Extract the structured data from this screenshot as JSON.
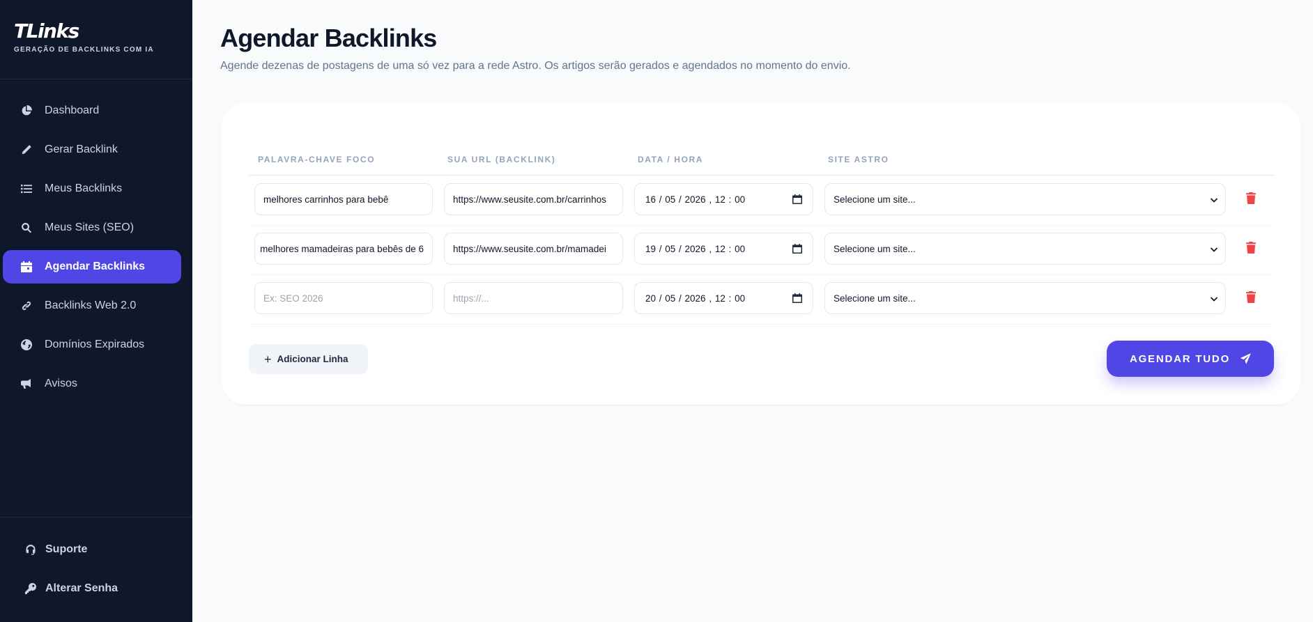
{
  "brand": {
    "title": "TLinks",
    "subtitle": "GERAÇÃO DE BACKLINKS COM IA"
  },
  "sidebar": {
    "items": [
      {
        "label": "Dashboard",
        "icon": "pie-chart-icon"
      },
      {
        "label": "Gerar Backlink",
        "icon": "pencil-icon"
      },
      {
        "label": "Meus Backlinks",
        "icon": "list-icon"
      },
      {
        "label": "Meus Sites (SEO)",
        "icon": "search-icon"
      },
      {
        "label": "Agendar Backlinks",
        "icon": "calendar-icon",
        "active": true
      },
      {
        "label": "Backlinks Web 2.0",
        "icon": "link-icon"
      },
      {
        "label": "Domínios Expirados",
        "icon": "globe-icon"
      },
      {
        "label": "Avisos",
        "icon": "megaphone-icon"
      }
    ],
    "footer": [
      {
        "label": "Suporte",
        "icon": "headset-icon"
      },
      {
        "label": "Alterar Senha",
        "icon": "key-icon"
      }
    ]
  },
  "page": {
    "title": "Agendar Backlinks",
    "subtitle": "Agende dezenas de postagens de uma só vez para a rede Astro. Os artigos serão gerados e agendados no momento do envio."
  },
  "table": {
    "headers": [
      "PALAVRA-CHAVE FOCO",
      "SUA URL (BACKLINK)",
      "DATA / HORA",
      "SITE ASTRO"
    ],
    "rows": [
      {
        "keyword": "melhores carrinhos para bebê",
        "url": "https://www.seusite.com.br/carrinhos",
        "datetime": "16 / 05 / 2026 ,  12 : 00",
        "site": "Selecione um site..."
      },
      {
        "keyword": "melhores mamadeiras para bebês de 6",
        "url": "https://www.seusite.com.br/mamadei",
        "datetime": "19 / 05 / 2026 ,  12 : 00",
        "site": "Selecione um site..."
      },
      {
        "keyword": "",
        "keyword_placeholder": "Ex: SEO 2026",
        "url": "",
        "url_placeholder": "https://...",
        "datetime": "20 / 05 / 2026 ,  12 : 00",
        "site": "Selecione um site..."
      }
    ]
  },
  "actions": {
    "add_row": "Adicionar Linha",
    "submit": "AGENDAR TUDO"
  },
  "colors": {
    "accent": "#4f46e5",
    "sidebar_bg": "#0f172a",
    "danger": "#ef4444"
  }
}
